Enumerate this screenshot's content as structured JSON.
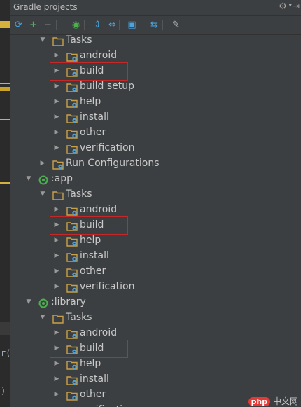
{
  "window": {
    "title": "Gradle projects"
  },
  "colors": {
    "folder": "#c8a148",
    "gear_badge": "#4aa3df",
    "gradle_green": "#4caf50",
    "highlight": "#c62828"
  },
  "toolbar": {
    "buttons": [
      {
        "name": "refresh-icon",
        "glyph": "⟳",
        "color": "#4aa3df"
      },
      {
        "name": "add-icon",
        "glyph": "+",
        "color": "#59a869"
      },
      {
        "name": "remove-icon",
        "glyph": "−",
        "color": "#777777"
      },
      {
        "name": "execute-task-icon",
        "glyph": "◉",
        "color": "#4caf50"
      },
      {
        "name": "expand-all-icon",
        "glyph": "⇕",
        "color": "#4aa3df"
      },
      {
        "name": "collapse-all-icon",
        "glyph": "⇔",
        "color": "#4aa3df"
      },
      {
        "name": "link-project-icon",
        "glyph": "▣",
        "color": "#4aa3df"
      },
      {
        "name": "offline-mode-icon",
        "glyph": "⇆",
        "color": "#4aa3df"
      },
      {
        "name": "gradle-settings-icon",
        "glyph": "✎",
        "color": "#bbbbbb"
      }
    ]
  },
  "tree": {
    "rows": [
      {
        "label": "Tasks",
        "level": 1,
        "expanded": true,
        "icon": "folder"
      },
      {
        "label": "android",
        "level": 2,
        "expanded": false,
        "icon": "folder-gear"
      },
      {
        "label": "build",
        "level": 2,
        "expanded": false,
        "icon": "folder-gear",
        "highlighted": true
      },
      {
        "label": "build setup",
        "level": 2,
        "expanded": false,
        "icon": "folder-gear"
      },
      {
        "label": "help",
        "level": 2,
        "expanded": false,
        "icon": "folder-gear"
      },
      {
        "label": "install",
        "level": 2,
        "expanded": false,
        "icon": "folder-gear"
      },
      {
        "label": "other",
        "level": 2,
        "expanded": false,
        "icon": "folder-gear"
      },
      {
        "label": "verification",
        "level": 2,
        "expanded": false,
        "icon": "folder-gear"
      },
      {
        "label": "Run Configurations",
        "level": 1,
        "expanded": false,
        "icon": "folder-gear"
      },
      {
        "label": ":app",
        "level": 0,
        "expanded": true,
        "icon": "gradle"
      },
      {
        "label": "Tasks",
        "level": 1,
        "expanded": true,
        "icon": "folder"
      },
      {
        "label": "android",
        "level": 2,
        "expanded": false,
        "icon": "folder-gear"
      },
      {
        "label": "build",
        "level": 2,
        "expanded": false,
        "icon": "folder-gear",
        "highlighted": true
      },
      {
        "label": "help",
        "level": 2,
        "expanded": false,
        "icon": "folder-gear"
      },
      {
        "label": "install",
        "level": 2,
        "expanded": false,
        "icon": "folder-gear"
      },
      {
        "label": "other",
        "level": 2,
        "expanded": false,
        "icon": "folder-gear"
      },
      {
        "label": "verification",
        "level": 2,
        "expanded": false,
        "icon": "folder-gear"
      },
      {
        "label": ":library",
        "level": 0,
        "expanded": true,
        "icon": "gradle"
      },
      {
        "label": "Tasks",
        "level": 1,
        "expanded": true,
        "icon": "folder"
      },
      {
        "label": "android",
        "level": 2,
        "expanded": false,
        "icon": "folder-gear"
      },
      {
        "label": "build",
        "level": 2,
        "expanded": false,
        "icon": "folder-gear",
        "highlighted": true
      },
      {
        "label": "help",
        "level": 2,
        "expanded": false,
        "icon": "folder-gear"
      },
      {
        "label": "install",
        "level": 2,
        "expanded": false,
        "icon": "folder-gear"
      },
      {
        "label": "other",
        "level": 2,
        "expanded": false,
        "icon": "folder-gear"
      },
      {
        "label": "verification",
        "level": 2,
        "expanded": false,
        "icon": "folder-gear"
      }
    ]
  },
  "left_strip": {
    "fragments": [
      "r(",
      ")"
    ]
  },
  "watermark": {
    "badge": "php",
    "text": "中文网"
  }
}
